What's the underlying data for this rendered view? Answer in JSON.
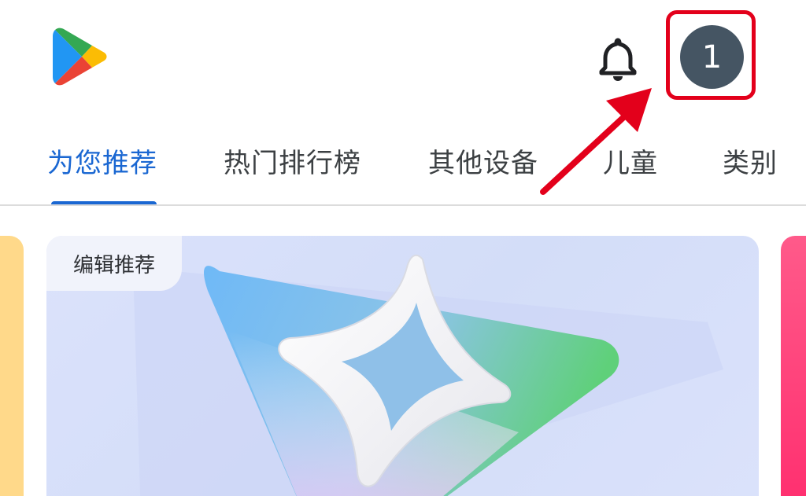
{
  "header": {
    "logo_icon": "google-play-logo",
    "notification_icon": "bell-icon",
    "avatar": {
      "initial": "1",
      "color": "#455563"
    }
  },
  "tabs": [
    {
      "label": "为您推荐",
      "active": true
    },
    {
      "label": "热门排行榜",
      "active": false
    },
    {
      "label": "其他设备",
      "active": false
    },
    {
      "label": "儿童",
      "active": false
    },
    {
      "label": "类别",
      "active": false
    }
  ],
  "featured_card": {
    "badge": "编辑推荐"
  },
  "colors": {
    "accent": "#1a67d2",
    "annotation": "#e3001b"
  }
}
